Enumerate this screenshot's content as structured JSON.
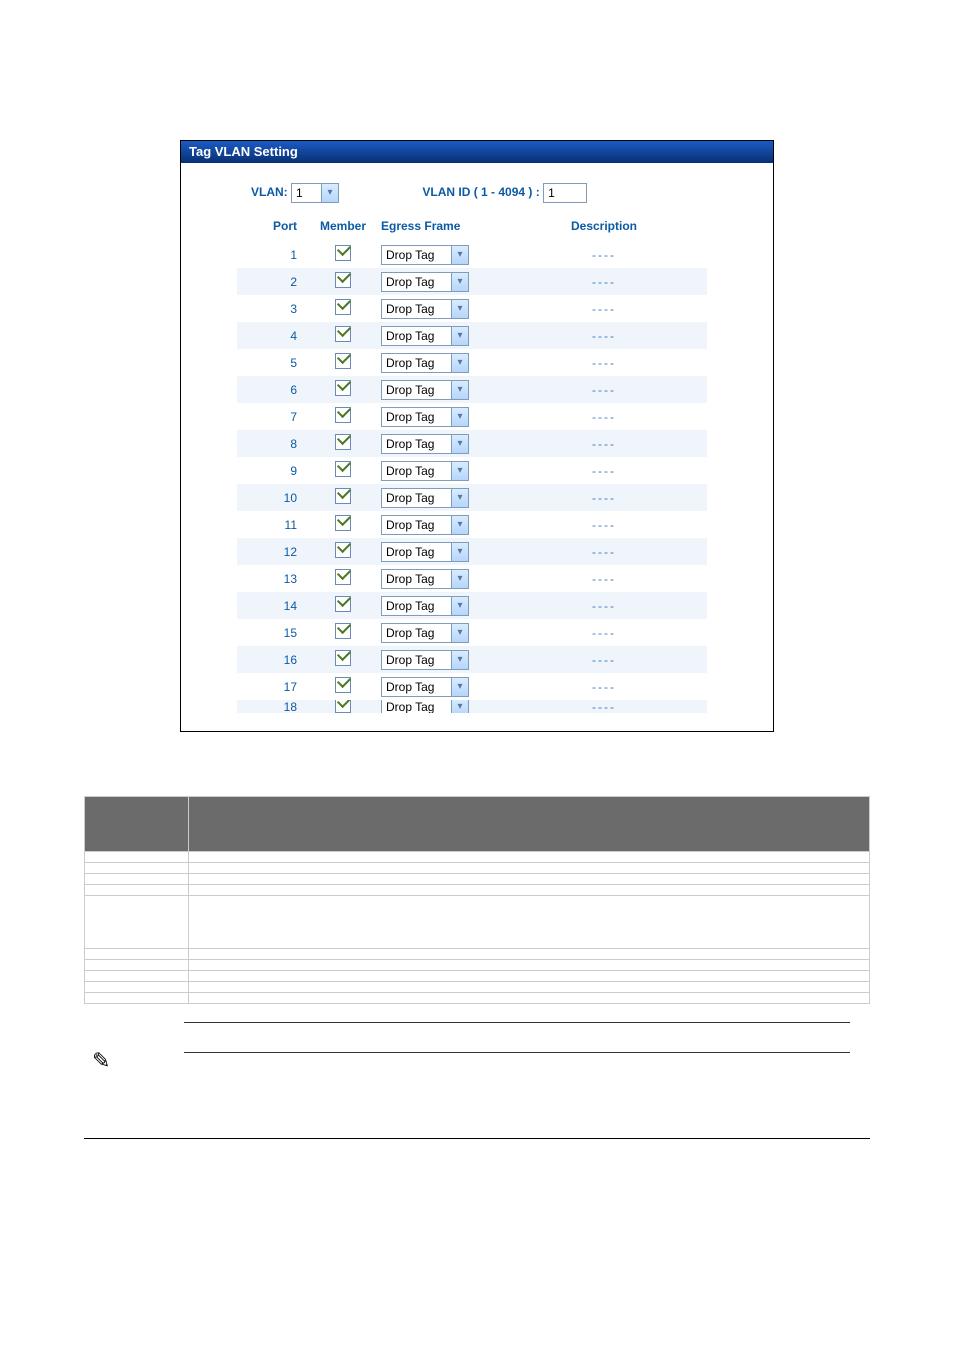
{
  "titlebar": {
    "text": "Tag VLAN Setting"
  },
  "top": {
    "vlan_label": "VLAN:",
    "vlan_value": "1",
    "id_label": "VLAN ID ( 1 - 4094 ) :",
    "id_value": "1"
  },
  "headers": {
    "port": "Port",
    "member": "Member",
    "egress": "Egress Frame",
    "desc": "Description"
  },
  "egress_option": "Drop Tag",
  "desc_placeholder": "----",
  "rows": [
    {
      "port": "1",
      "member": true
    },
    {
      "port": "2",
      "member": true
    },
    {
      "port": "3",
      "member": true
    },
    {
      "port": "4",
      "member": true
    },
    {
      "port": "5",
      "member": true
    },
    {
      "port": "6",
      "member": true
    },
    {
      "port": "7",
      "member": true
    },
    {
      "port": "8",
      "member": true
    },
    {
      "port": "9",
      "member": true
    },
    {
      "port": "10",
      "member": true
    },
    {
      "port": "11",
      "member": true
    },
    {
      "port": "12",
      "member": true
    },
    {
      "port": "13",
      "member": true
    },
    {
      "port": "14",
      "member": true
    },
    {
      "port": "15",
      "member": true
    },
    {
      "port": "16",
      "member": true
    },
    {
      "port": "17",
      "member": true
    },
    {
      "port": "18",
      "member": true
    }
  ],
  "legend": {
    "h_obj": "",
    "h_desc": "",
    "rows": [
      {
        "k": "",
        "v": ""
      },
      {
        "k": "",
        "v": ""
      },
      {
        "k": "",
        "v": ""
      },
      {
        "k": "",
        "v": ""
      },
      {
        "k": "",
        "v": ""
      },
      {
        "k": "",
        "v": ""
      },
      {
        "k": "",
        "v": ""
      },
      {
        "k": "",
        "v": ""
      },
      {
        "k": "",
        "v": ""
      },
      {
        "k": "",
        "v": ""
      }
    ]
  }
}
